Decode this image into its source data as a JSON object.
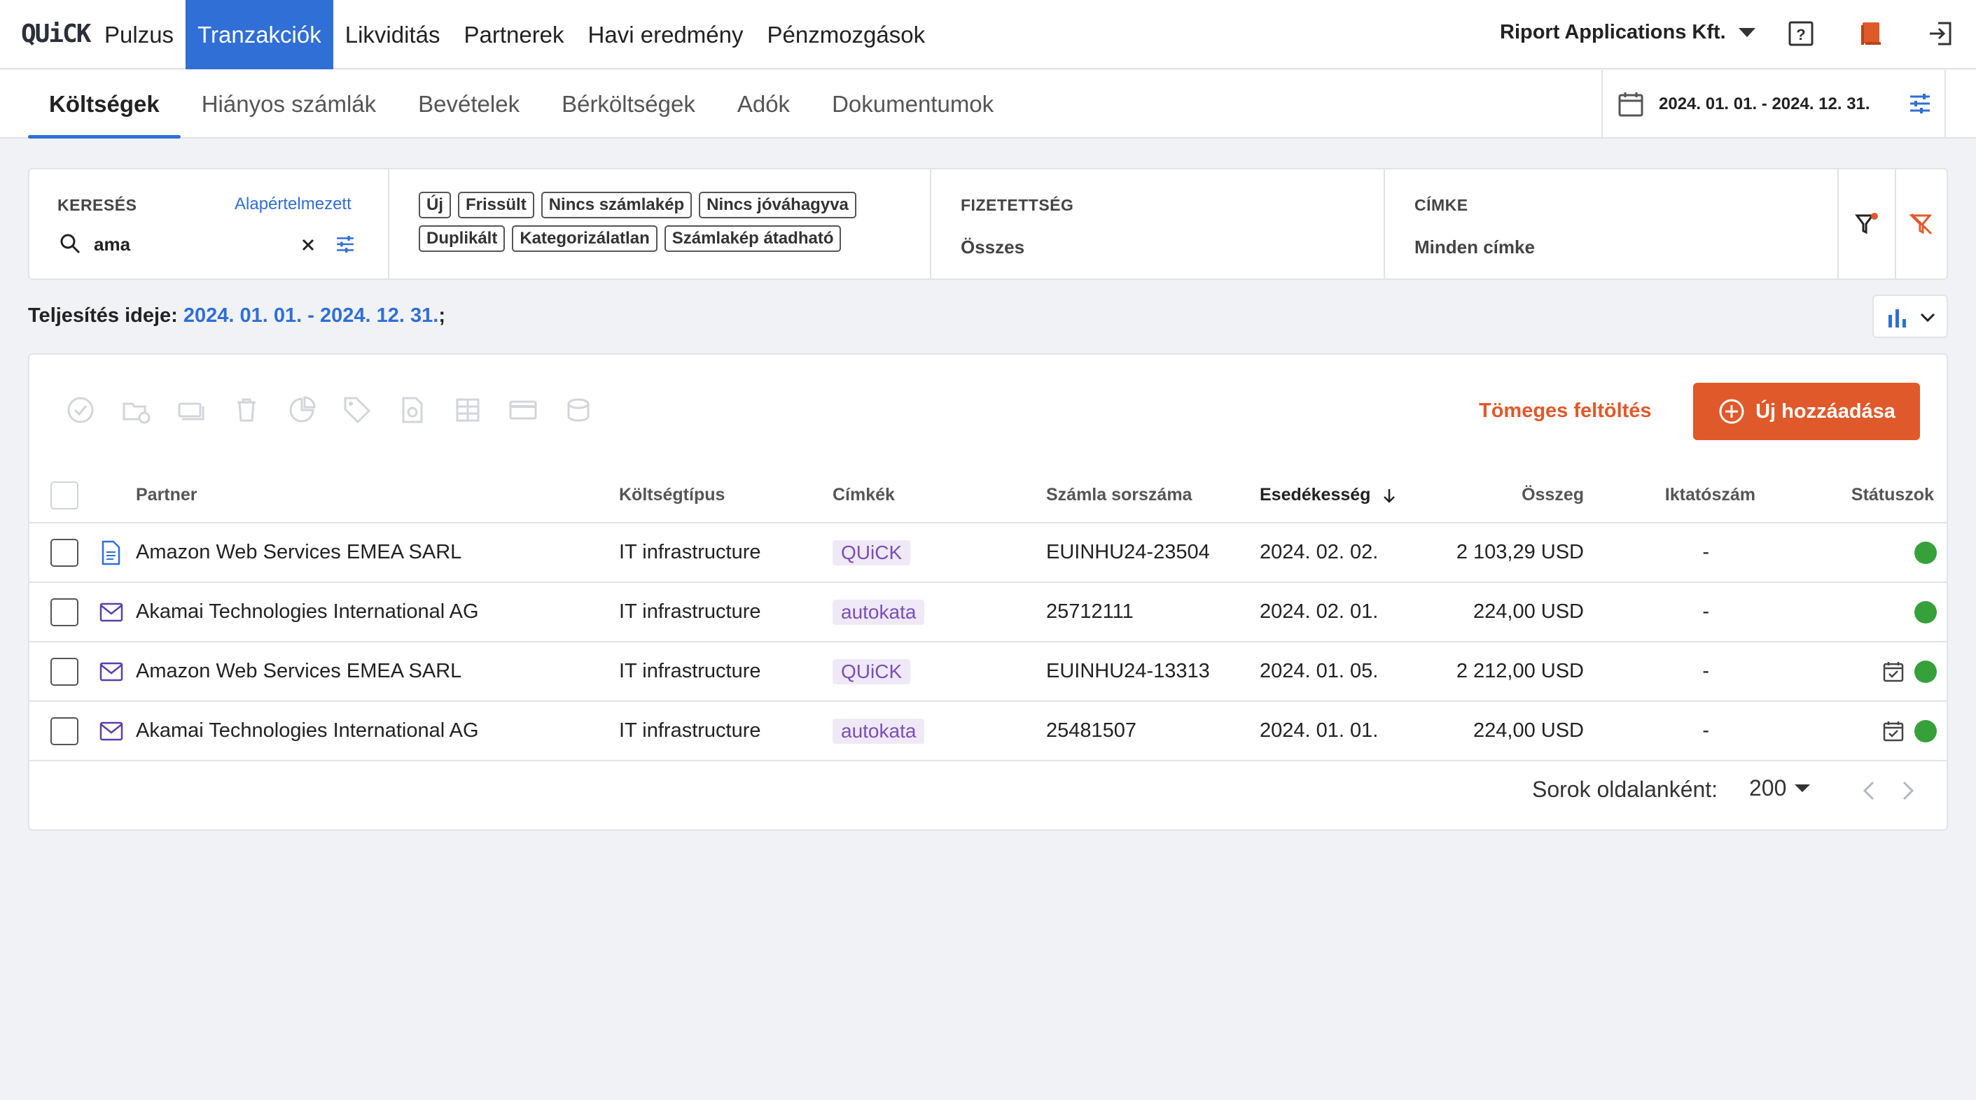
{
  "topbar": {
    "logo": "QUiCK",
    "nav": [
      {
        "label": "Pulzus",
        "active": false
      },
      {
        "label": "Tranzakciók",
        "active": true
      },
      {
        "label": "Likviditás",
        "active": false
      },
      {
        "label": "Partnerek",
        "active": false
      },
      {
        "label": "Havi eredmény",
        "active": false
      },
      {
        "label": "Pénzmozgások",
        "active": false
      }
    ],
    "company": "Riport Applications Kft.",
    "icons": [
      "help-icon",
      "book-icon",
      "logout-icon"
    ]
  },
  "subnav": {
    "tabs": [
      {
        "label": "Költségek",
        "active": true
      },
      {
        "label": "Hiányos számlák",
        "active": false
      },
      {
        "label": "Bevételek",
        "active": false
      },
      {
        "label": "Bérköltségek",
        "active": false
      },
      {
        "label": "Adók",
        "active": false
      },
      {
        "label": "Dokumentumok",
        "active": false
      }
    ],
    "date_range": "2024. 01. 01. - 2024. 12. 31."
  },
  "filters": {
    "search_label": "KERESÉS",
    "default_link": "Alapértelmezett",
    "search_value": "ama",
    "chips": [
      "Új",
      "Frissült",
      "Nincs számlakép",
      "Nincs jóváhagyva",
      "Duplikált",
      "Kategorizálatlan",
      "Számlakép átadható"
    ],
    "payment_label": "FIZETETTSÉG",
    "payment_value": "Összes",
    "tag_label": "CÍMKE",
    "tag_value": "Minden címke"
  },
  "period": {
    "label": "Teljesítés ideje:",
    "dates": "2024. 01. 01. - 2024. 12. 31.",
    "suffix": ";"
  },
  "actions": {
    "bulk_upload": "Tömeges feltöltés",
    "add_new": "Új hozzáadása"
  },
  "table": {
    "headers": {
      "partner": "Partner",
      "cost_type": "Költségtípus",
      "tags": "Címkék",
      "invoice_no": "Számla sorszáma",
      "due": "Esedékesség",
      "amount": "Összeg",
      "filing_no": "Iktatószám",
      "statuses": "Státuszok"
    },
    "rows": [
      {
        "doc_icon": "document-icon",
        "partner": "Amazon Web Services EMEA SARL",
        "cost_type": "IT infrastructure",
        "tag": "QUiCK",
        "invoice_no": "EUINHU24-23504",
        "due": "2024. 02. 02.",
        "amount": "2 103,29 USD",
        "filing_no": "-",
        "calendar": false
      },
      {
        "doc_icon": "mail-icon",
        "partner": "Akamai Technologies International AG",
        "cost_type": "IT infrastructure",
        "tag": "autokata",
        "invoice_no": "25712111",
        "due": "2024. 02. 01.",
        "amount": "224,00 USD",
        "filing_no": "-",
        "calendar": false
      },
      {
        "doc_icon": "mail-icon",
        "partner": "Amazon Web Services EMEA SARL",
        "cost_type": "IT infrastructure",
        "tag": "QUiCK",
        "invoice_no": "EUINHU24-13313",
        "due": "2024. 01. 05.",
        "amount": "2 212,00 USD",
        "filing_no": "-",
        "calendar": true
      },
      {
        "doc_icon": "mail-icon",
        "partner": "Akamai Technologies International AG",
        "cost_type": "IT infrastructure",
        "tag": "autokata",
        "invoice_no": "25481507",
        "due": "2024. 01. 01.",
        "amount": "224,00 USD",
        "filing_no": "-",
        "calendar": true
      }
    ]
  },
  "pagination": {
    "rows_label": "Sorok oldalanként:",
    "rows_value": "200"
  },
  "colors": {
    "primary": "#2f6fd6",
    "accent": "#e0592a",
    "status_green": "#36a13a",
    "tag_bg": "#efe9f7",
    "tag_text": "#7a4fb5"
  }
}
